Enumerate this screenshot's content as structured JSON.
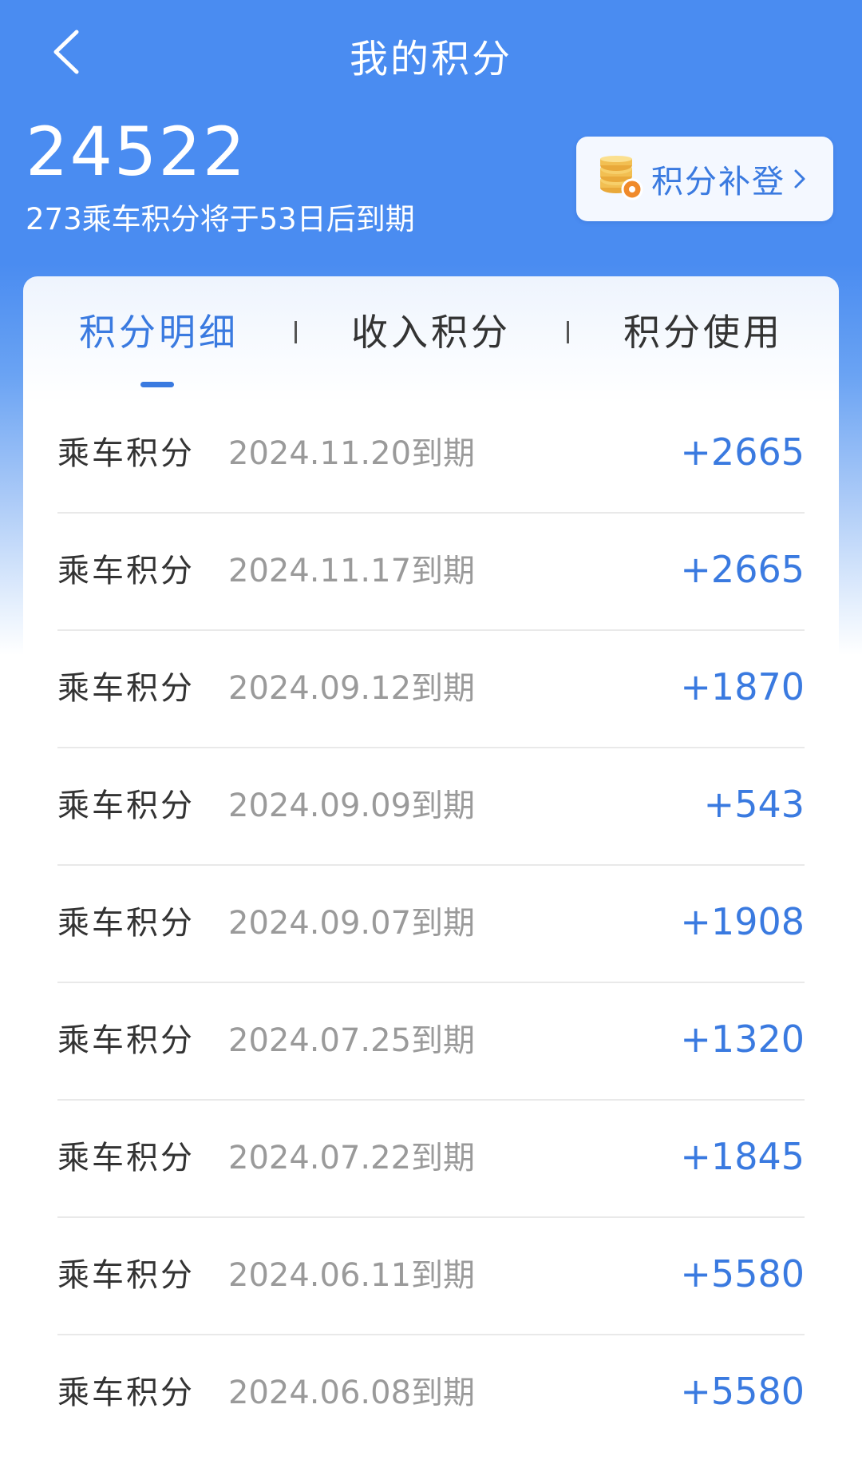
{
  "header": {
    "title": "我的积分"
  },
  "summary": {
    "balance": "24522",
    "expire_note": "273乘车积分将于53日后到期",
    "supplement_label": "积分补登"
  },
  "tabs": [
    {
      "label": "积分明细",
      "active": true
    },
    {
      "label": "收入积分",
      "active": false
    },
    {
      "label": "积分使用",
      "active": false
    }
  ],
  "records": [
    {
      "type": "乘车积分",
      "date": "2024.11.20到期",
      "points": "+2665"
    },
    {
      "type": "乘车积分",
      "date": "2024.11.17到期",
      "points": "+2665"
    },
    {
      "type": "乘车积分",
      "date": "2024.09.12到期",
      "points": "+1870"
    },
    {
      "type": "乘车积分",
      "date": "2024.09.09到期",
      "points": "+543"
    },
    {
      "type": "乘车积分",
      "date": "2024.09.07到期",
      "points": "+1908"
    },
    {
      "type": "乘车积分",
      "date": "2024.07.25到期",
      "points": "+1320"
    },
    {
      "type": "乘车积分",
      "date": "2024.07.22到期",
      "points": "+1845"
    },
    {
      "type": "乘车积分",
      "date": "2024.06.11到期",
      "points": "+5580"
    },
    {
      "type": "乘车积分",
      "date": "2024.06.08到期",
      "points": "+5580"
    }
  ],
  "colors": {
    "header_blue": "#4a8cf1",
    "accent_blue": "#3a7ae0",
    "text_dark": "#333333",
    "text_gray": "#9a9a9a"
  },
  "icons": {
    "back": "chevron-left-icon",
    "coin": "coin-stack-icon",
    "chevron": "chevron-right-icon"
  }
}
